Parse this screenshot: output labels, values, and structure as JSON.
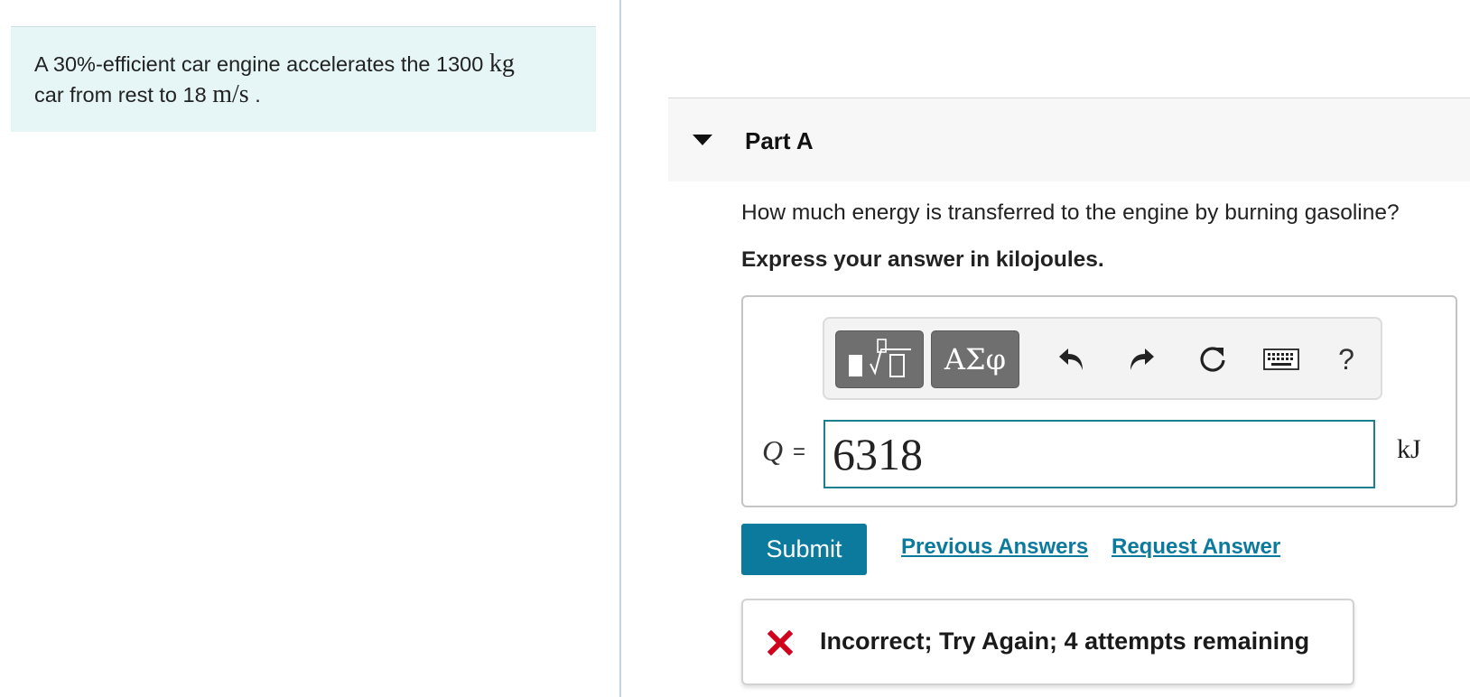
{
  "problem": {
    "text_prefix": "A 30%-efficient car engine accelerates the 1300",
    "mass_unit": "kg",
    "text_middle": "car from rest to 18",
    "speed_unit": "m/s",
    "text_suffix": "."
  },
  "part": {
    "title": "Part A",
    "question": "How much energy is transferred to the engine by burning gasoline?",
    "instruction": "Express your answer in kilojoules."
  },
  "toolbar": {
    "templates_icon": "templates-sqrt-icon",
    "greek_label": "ΑΣφ",
    "undo_icon": "undo-icon",
    "redo_icon": "redo-icon",
    "reset_icon": "reset-icon",
    "keyboard_icon": "keyboard-icon",
    "help_label": "?"
  },
  "answer": {
    "variable": "Q",
    "equals": "=",
    "value": "6318",
    "unit": "kJ"
  },
  "actions": {
    "submit_label": "Submit",
    "previous_answers_label": "Previous Answers",
    "request_answer_label": "Request Answer"
  },
  "feedback": {
    "icon": "x-icon",
    "message": "Incorrect; Try Again; 4 attempts remaining",
    "status_color": "#d0021b"
  },
  "colors": {
    "accent": "#0b7a9d",
    "problem_bg": "#e6f5f5",
    "input_border": "#1b7f8f"
  }
}
